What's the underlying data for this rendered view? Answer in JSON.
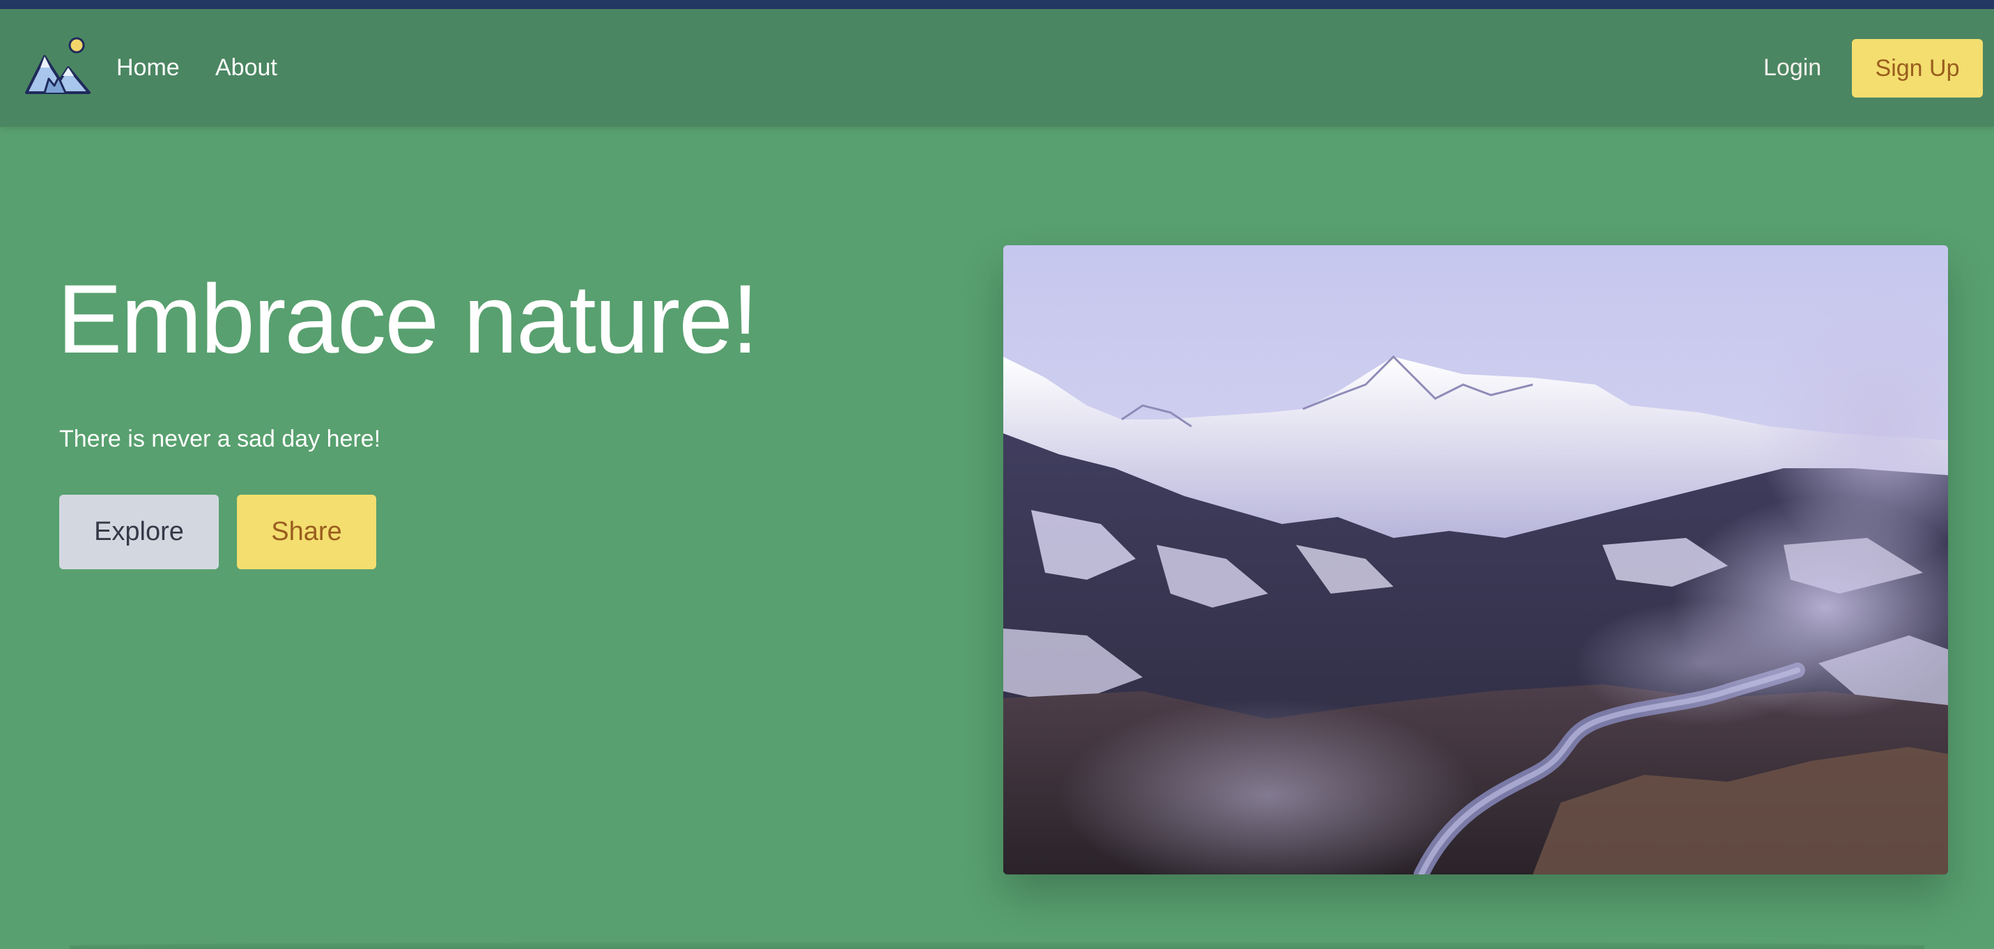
{
  "nav": {
    "logo_icon": "mountain-sun-logo",
    "links": [
      {
        "label": "Home"
      },
      {
        "label": "About"
      }
    ],
    "login_label": "Login",
    "signup_label": "Sign Up"
  },
  "hero": {
    "title": "Embrace nature!",
    "subtitle": "There is never a sad day here!",
    "explore_label": "Explore",
    "share_label": "Share",
    "image_subject": "snowy mountain valley with steaming hot springs"
  },
  "colors": {
    "topbar": "#233863",
    "navbar": "#4b8662",
    "background": "#58a06f",
    "accent_yellow": "#f3de6f",
    "accent_text": "#9a5d1e",
    "secondary_button": "#d3d8e0"
  }
}
